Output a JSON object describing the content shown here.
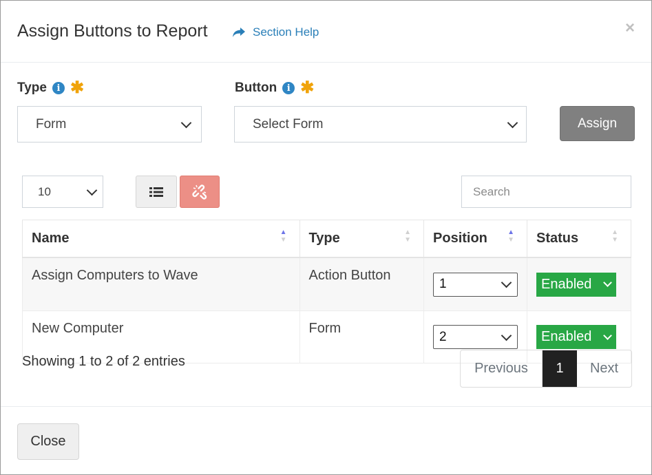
{
  "dialog": {
    "title": "Assign Buttons to Report",
    "help_label": "Section Help",
    "close_x": "×"
  },
  "form": {
    "type_label": "Type",
    "type_value": "Form",
    "button_label": "Button",
    "button_value": "Select Form",
    "assign_label": "Assign",
    "info_glyph": "i",
    "required_glyph": "✱"
  },
  "table_controls": {
    "page_length": "10",
    "search_placeholder": "Search"
  },
  "table": {
    "columns": [
      "Name",
      "Type",
      "Position",
      "Status"
    ],
    "rows": [
      {
        "name": "Assign Computers to Wave",
        "type": "Action Button",
        "position": "1",
        "status": "Enabled"
      },
      {
        "name": "New Computer",
        "type": "Form",
        "position": "2",
        "status": "Enabled"
      }
    ]
  },
  "footer_info": "Showing 1 to 2 of 2 entries",
  "pagination": {
    "previous": "Previous",
    "current": "1",
    "next": "Next"
  },
  "footer": {
    "close_label": "Close"
  },
  "colors": {
    "enabled": "#28a745",
    "unlink_button": "#ec8f86",
    "assign_button": "#808080",
    "link": "#2a7fb8",
    "required": "#f0a30a"
  },
  "icons": {
    "help": "share-arrow-icon",
    "list": "list-icon",
    "unlink": "unlink-icon"
  }
}
